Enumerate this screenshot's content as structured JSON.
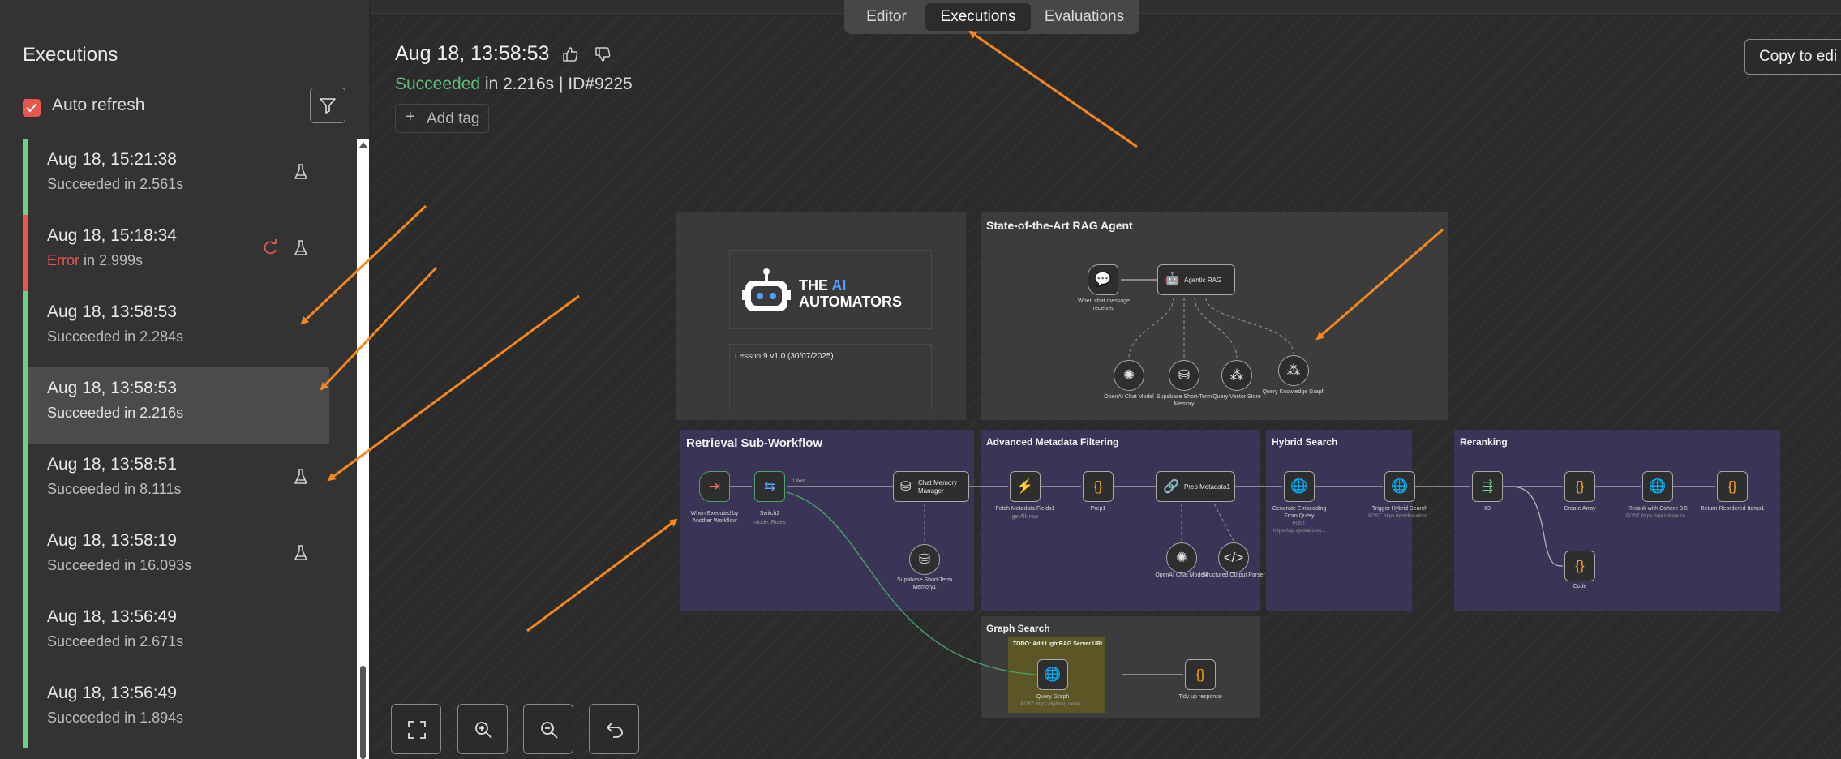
{
  "sidebar": {
    "title": "Executions",
    "auto_refresh_label": "Auto refresh",
    "executions": [
      {
        "date": "Aug 18, 15:21:38",
        "status": "Succeeded",
        "duration": " in 2.561s",
        "state": "success"
      },
      {
        "date": "Aug 18, 15:18:34",
        "status": "Error",
        "duration": " in 2.999s",
        "state": "error"
      },
      {
        "date": "Aug 18, 13:58:53",
        "status": "Succeeded",
        "duration": " in 2.284s",
        "state": "success"
      },
      {
        "date": "Aug 18, 13:58:53",
        "status": "Succeeded",
        "duration": " in 2.216s",
        "state": "selected"
      },
      {
        "date": "Aug 18, 13:58:51",
        "status": "Succeeded",
        "duration": " in 8.111s",
        "state": "success"
      },
      {
        "date": "Aug 18, 13:58:19",
        "status": "Succeeded",
        "duration": " in 16.093s",
        "state": "success"
      },
      {
        "date": "Aug 18, 13:56:49",
        "status": "Succeeded",
        "duration": " in 2.671s",
        "state": "success"
      },
      {
        "date": "Aug 18, 13:56:49",
        "status": "Succeeded",
        "duration": " in 1.894s",
        "state": "success"
      }
    ]
  },
  "tabs": [
    {
      "label": "Editor",
      "active": false
    },
    {
      "label": "Executions",
      "active": true
    },
    {
      "label": "Evaluations",
      "active": false
    }
  ],
  "header": {
    "date": "Aug 18, 13:58:53",
    "status": "Succeeded",
    "duration": " in 2.216s | ID#9225",
    "add_tag": "Add tag",
    "copy_button": "Copy to edi"
  },
  "workflow": {
    "logo_line1a": "THE ",
    "logo_line1b": "AI",
    "logo_line2": "AUTOMATORS",
    "lesson": "Lesson 9 v1.0 (30/07/2025)",
    "rag_agent": {
      "title": "State-of-the-Art RAG Agent",
      "trigger": "When chat message received",
      "agent": "Agentic RAG",
      "tools": [
        "OpenAI Chat Model",
        "Supabase Short-Term Memory",
        "Query Vector Store",
        "Query Knowledge Graph"
      ]
    },
    "retrieval": {
      "title": "Retrieval Sub-Workflow",
      "trigger": "When Executed by Another Workflow",
      "switch": "Switch2",
      "switch_sub": "mode: Rules",
      "memory_manager": "Chat Memory Manager",
      "memory": "Supabase Short-Term Memory1",
      "items_label": "1 item"
    },
    "metadata": {
      "title": "Advanced Metadata Filtering",
      "fetch": "Fetch Metadata Fields1",
      "fetch_sub": "getAll: row",
      "prep": "Prep1",
      "prep_meta": "Prep Metadata1",
      "chat_model": "OpenAI Chat Model4",
      "parser": "Structured Output Parser"
    },
    "hybrid": {
      "title": "Hybrid Search",
      "embed": "Generate Embedding From Query",
      "embed_sub": "POST: https://api.openai.com...",
      "trigger": "Trigger Hybrid Search",
      "trigger_sub": "POST: https://xbmfnsuubcq..."
    },
    "rerank": {
      "title": "Reranking",
      "if": "If3",
      "create": "Create Array",
      "rerank": "Rerank with Cohere 3.5",
      "rerank_sub": "POST: https://api.cohere.co...",
      "return": "Return Reordered Items1",
      "code": "Code"
    },
    "graph": {
      "title": "Graph Search",
      "todo": "TODO: Add LightRAG Server URL",
      "query": "Query Graph",
      "query_sub": "POST: https://lightrag.railwa...",
      "tidy": "Tidy up response"
    }
  },
  "colors": {
    "success": "#6fcf8a",
    "error": "#e8574e",
    "annotation_arrow": "#f5871f",
    "sticky_purple": "#3a3556",
    "sticky_gray": "#3c3c3c"
  }
}
